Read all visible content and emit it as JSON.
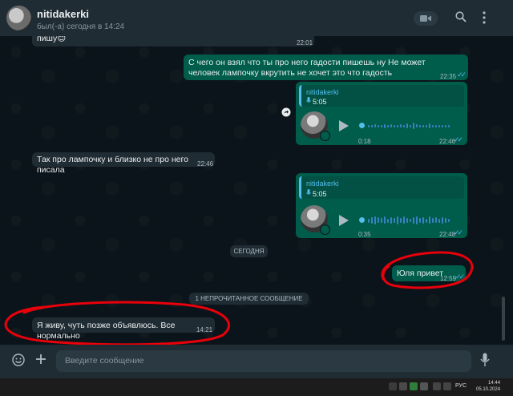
{
  "header": {
    "contact_name": "nitidakerki",
    "status": "был(-а) сегодня в 14:24"
  },
  "messages": {
    "m0": {
      "text": "пишу😊",
      "time": "22:01"
    },
    "m1": {
      "text": "С чего он взял что ты про него гадости пишешь ну Не может человек лампочку вкрутить не хочет это что гадость",
      "time": "22:35"
    },
    "v1": {
      "sender": "nitidakerki",
      "duration": "5:05",
      "position": "0:18",
      "time": "22:46"
    },
    "m2": {
      "text": "Так про лампочку и близко не про него писала",
      "time": "22:46"
    },
    "v2": {
      "sender": "nitidakerki",
      "duration": "5:05",
      "position": "0:35",
      "time": "22:48"
    },
    "m3": {
      "text": "Юля привет",
      "time": "12:59"
    },
    "m4": {
      "text": "Я живу, чуть позже объявлюсь. Все нормально",
      "time": "14:21"
    }
  },
  "date_pill": "СЕГОДНЯ",
  "unread_pill": "1 НЕПРОЧИТАННОЕ СООБЩЕНИЕ",
  "composer": {
    "placeholder": "Введите сообщение"
  },
  "taskbar": {
    "language": "РУС",
    "time": "14:44",
    "date": "05.10.2024"
  },
  "colors": {
    "background": "#0b141a",
    "header": "#202c33",
    "incoming_bubble": "#202c33",
    "outgoing_bubble": "#005c4b",
    "accent_blue": "#53bdeb",
    "annotation_red": "#e8000b"
  },
  "icons": {
    "video": "video-icon",
    "search": "search-icon",
    "menu": "kebab-menu-icon",
    "emoji": "emoji-icon",
    "attach": "plus-icon",
    "mic": "microphone-icon",
    "forward": "forward-icon"
  }
}
